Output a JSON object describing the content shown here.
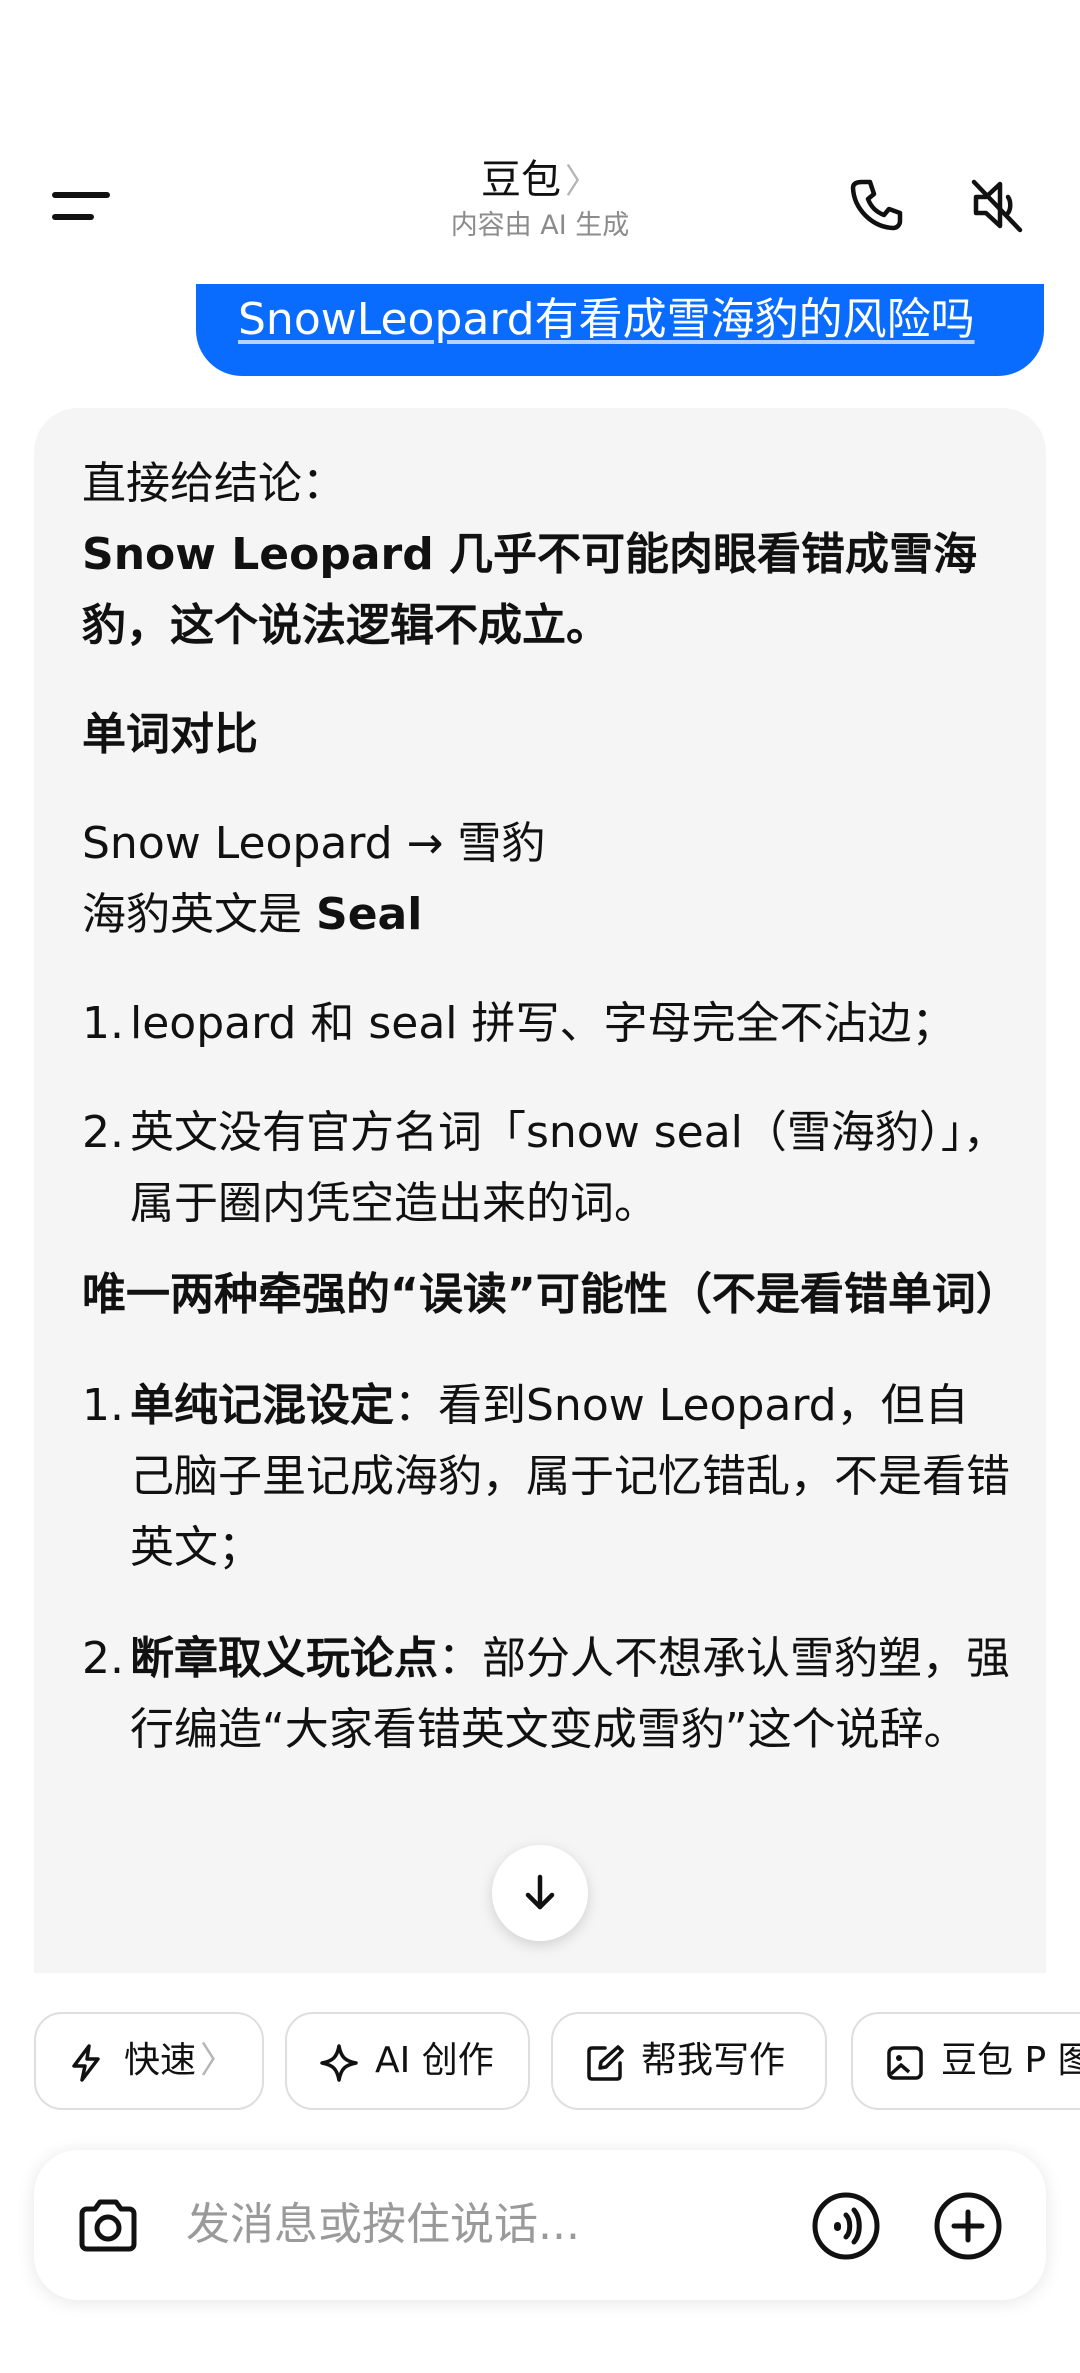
{
  "header": {
    "title": "豆包",
    "title_chevron": "〉",
    "subtitle": "内容由 AI 生成",
    "icons": [
      "menu-icon",
      "phone-icon",
      "speaker-muted-icon"
    ]
  },
  "user_message": {
    "text": "SnowLeopard有看成雪海豹的风险吗"
  },
  "answer": {
    "intro": "直接给结论：",
    "conclusion": "Snow Leopard 几乎不可能肉眼看错成雪海豹，这个说法逻辑不成立。",
    "section1_title": "单词对比",
    "compare_line1": "Snow Leopard → 雪豹",
    "compare_line2_prefix": "海豹英文是 ",
    "compare_line2_bold": "Seal",
    "list1": [
      {
        "num": "1.",
        "text": "leopard 和 seal 拼写、字母完全不沾边；"
      },
      {
        "num": "2.",
        "text": "英文没有官方名词「snow seal（雪海豹）」，属于圈内凭空造出来的词。"
      }
    ],
    "section2_title": "唯一两种牵强的“误读”可能性（不是看错单词）",
    "list2": [
      {
        "num": "1.",
        "bold": "单纯记混设定",
        "text": "：看到Snow Leopard，但自己脑子里记成海豹，属于记忆错乱，不是看错英文；"
      },
      {
        "num": "2.",
        "bold": "断章取义玩论点",
        "text": "：部分人不想承认雪豹塑，强行编造“大家看错英文变成雪豹”这个说辞。"
      }
    ]
  },
  "quick_actions": [
    {
      "label": "快速",
      "chevron": "〉",
      "icon": "lightning-icon"
    },
    {
      "label": "AI 创作",
      "icon": "sparkle-icon"
    },
    {
      "label": "帮我写作",
      "icon": "edit-icon"
    },
    {
      "label": "豆包 P 图",
      "icon": "image-edit-icon"
    }
  ],
  "input": {
    "placeholder": "发消息或按住说话..."
  },
  "colors": {
    "accent": "#0a6cff",
    "card_bg": "#f5f5f5"
  }
}
